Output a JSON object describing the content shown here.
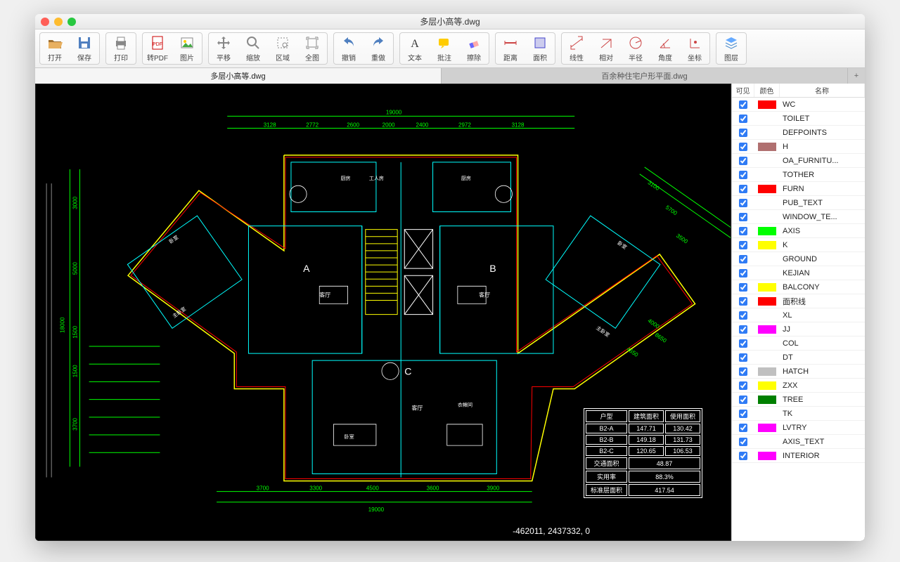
{
  "window": {
    "title": "多层小高等.dwg"
  },
  "toolbar": [
    {
      "label": "打开",
      "icon": "folder-open"
    },
    {
      "label": "保存",
      "icon": "save"
    },
    {
      "label": "打印",
      "icon": "print"
    },
    {
      "label": "转PDF",
      "icon": "pdf"
    },
    {
      "label": "图片",
      "icon": "image"
    },
    {
      "label": "平移",
      "icon": "pan"
    },
    {
      "label": "缩放",
      "icon": "zoom"
    },
    {
      "label": "区域",
      "icon": "region"
    },
    {
      "label": "全图",
      "icon": "extent"
    },
    {
      "label": "撤销",
      "icon": "undo"
    },
    {
      "label": "重做",
      "icon": "redo"
    },
    {
      "label": "文本",
      "icon": "text"
    },
    {
      "label": "批注",
      "icon": "annotate"
    },
    {
      "label": "擦除",
      "icon": "erase"
    },
    {
      "label": "距离",
      "icon": "dist"
    },
    {
      "label": "面积",
      "icon": "area"
    },
    {
      "label": "线性",
      "icon": "linear"
    },
    {
      "label": "相对",
      "icon": "rel"
    },
    {
      "label": "半径",
      "icon": "radius"
    },
    {
      "label": "角度",
      "icon": "angle"
    },
    {
      "label": "坐标",
      "icon": "coord"
    },
    {
      "label": "图层",
      "icon": "layers"
    }
  ],
  "toolbar_groups": [
    [
      0,
      1
    ],
    [
      2
    ],
    [
      3,
      4
    ],
    [
      5,
      6,
      7,
      8
    ],
    [
      9,
      10
    ],
    [
      11,
      12,
      13
    ],
    [
      14,
      15
    ],
    [
      16,
      17,
      18,
      19,
      20
    ],
    [
      21
    ]
  ],
  "tabs": [
    {
      "label": "多层小高等.dwg",
      "active": true
    },
    {
      "label": "百余种住宅户形平面.dwg",
      "active": false
    }
  ],
  "layerpanel": {
    "headers": {
      "visible": "可见",
      "color": "颜色",
      "name": "名称"
    },
    "layers": [
      {
        "name": "WC",
        "color": "#ff0000"
      },
      {
        "name": "TOILET",
        "color": "#ffffff"
      },
      {
        "name": "DEFPOINTS",
        "color": "#ffffff"
      },
      {
        "name": "H",
        "color": "#b07070"
      },
      {
        "name": "OA_FURNITU...",
        "color": "#ffffff"
      },
      {
        "name": "TOTHER",
        "color": "#ffffff"
      },
      {
        "name": "FURN",
        "color": "#ff0000"
      },
      {
        "name": "PUB_TEXT",
        "color": "#ffffff"
      },
      {
        "name": "WINDOW_TE...",
        "color": "#ffffff"
      },
      {
        "name": "AXIS",
        "color": "#00ff00"
      },
      {
        "name": "K",
        "color": "#ffff00"
      },
      {
        "name": "GROUND",
        "color": "#ffffff"
      },
      {
        "name": "KEJIAN",
        "color": "#ffffff"
      },
      {
        "name": "BALCONY",
        "color": "#ffff00"
      },
      {
        "name": "面积线",
        "color": "#ff0000"
      },
      {
        "name": "XL",
        "color": "#ffffff"
      },
      {
        "name": "JJ",
        "color": "#ff00ff"
      },
      {
        "name": "COL",
        "color": "#ffffff"
      },
      {
        "name": "DT",
        "color": "#ffffff"
      },
      {
        "name": "HATCH",
        "color": "#c0c0c0"
      },
      {
        "name": "ZXX",
        "color": "#ffff00"
      },
      {
        "name": "TREE",
        "color": "#008000"
      },
      {
        "name": "TK",
        "color": "#ffffff"
      },
      {
        "name": "LVTRY",
        "color": "#ff00ff"
      },
      {
        "name": "AXIS_TEXT",
        "color": "#ffffff"
      },
      {
        "name": "INTERIOR",
        "color": "#ff00ff"
      }
    ]
  },
  "coord_readout": "-462011, 2437332, 0",
  "dimensions": {
    "top_total": "19000",
    "top_segs": [
      "3128",
      "2772",
      "2600",
      "2000",
      "2400",
      "2972",
      "3128"
    ],
    "bottom_total": "19000",
    "bottom_segs": [
      "3700",
      "3300",
      "4500",
      "3600",
      "3900"
    ],
    "left_total": "18000",
    "left_segs": [
      "3000",
      "5000",
      "1500",
      "1500",
      "3700"
    ],
    "right_diag": [
      "3100",
      "5700",
      "3500",
      "4000",
      "4650",
      "8650"
    ]
  },
  "units": {
    "A": "A",
    "B": "B",
    "C": "C"
  },
  "rooms": {
    "living": "客厅",
    "bedroom": "卧室",
    "master": "主卧室",
    "kitchen": "厨房",
    "worker": "工人房",
    "storage": "衣帽间"
  },
  "table": {
    "headers": [
      "户型",
      "建筑面积",
      "使用面积"
    ],
    "rows": [
      [
        "B2-A",
        "147.71",
        "130.42"
      ],
      [
        "B2-B",
        "149.18",
        "131.73"
      ],
      [
        "B2-C",
        "120.65",
        "106.53"
      ]
    ],
    "summary": [
      [
        "交通面积",
        "48.87"
      ],
      [
        "实用率",
        "88.3%"
      ],
      [
        "标准层面积",
        "417.54"
      ]
    ]
  }
}
